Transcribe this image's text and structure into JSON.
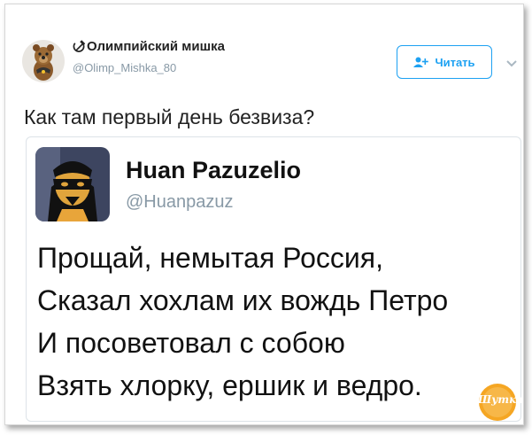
{
  "tweet": {
    "display_name": "Олимпийский мишка",
    "handle": "@Olimp_Mishka_80",
    "follow_label": "Читать",
    "text": "Как там первый день безвиза?"
  },
  "quoted": {
    "display_name": "Huan Pazuzelio",
    "handle": "@Huanpazuz",
    "lines": [
      "Прощай, немытая Россия,",
      "Сказал хохлам их вождь Петро",
      "И посоветовал с собою",
      "Взять хлорку, ершик и ведро."
    ]
  },
  "watermark": {
    "text": "Шутка"
  },
  "colors": {
    "accent": "#1da1f2",
    "handle_gray": "#8899a6",
    "watermark": "#f5a623"
  },
  "icons": {
    "hammer_sickle": "hammer-sickle-icon",
    "follow": "add-user-icon",
    "menu": "chevron-down-icon"
  }
}
